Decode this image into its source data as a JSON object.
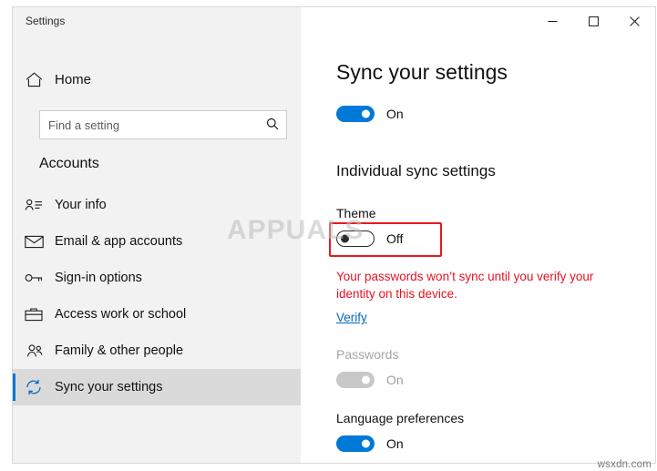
{
  "window": {
    "app_title": "Settings",
    "caption": {
      "minimize": "minimize",
      "maximize": "maximize",
      "close": "close"
    }
  },
  "sidebar": {
    "home_label": "Home",
    "search": {
      "placeholder": "Find a setting",
      "value": ""
    },
    "category": "Accounts",
    "items": [
      {
        "label": "Your info",
        "icon": "user-info-icon",
        "selected": false
      },
      {
        "label": "Email & app accounts",
        "icon": "mail-icon",
        "selected": false
      },
      {
        "label": "Sign-in options",
        "icon": "key-icon",
        "selected": false
      },
      {
        "label": "Access work or school",
        "icon": "briefcase-icon",
        "selected": false
      },
      {
        "label": "Family & other people",
        "icon": "people-icon",
        "selected": false
      },
      {
        "label": "Sync your settings",
        "icon": "sync-icon",
        "selected": true
      }
    ]
  },
  "main": {
    "page_title": "Sync your settings",
    "master_toggle": {
      "state_label": "On",
      "state": "on"
    },
    "section_title": "Individual sync settings",
    "settings": [
      {
        "label": "Theme",
        "state_label": "Off",
        "state": "off",
        "highlighted": true
      },
      {
        "label": "Passwords",
        "state_label": "On",
        "state": "disabled",
        "highlighted": false
      },
      {
        "label": "Language preferences",
        "state_label": "On",
        "state": "on",
        "highlighted": false
      }
    ],
    "warning_text": "Your passwords won’t sync until you verify your identity on this device.",
    "verify_link": "Verify"
  },
  "overlay": {
    "watermark": "APPUALS",
    "corner_label": "wsxdn.com"
  },
  "colors": {
    "accent": "#0078d7",
    "warning": "#e81123",
    "highlight_box": "#e8191f",
    "link": "#0067c0"
  }
}
